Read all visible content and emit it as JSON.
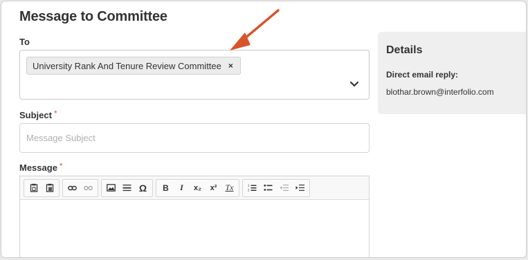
{
  "form": {
    "title": "Message to Committee",
    "to_label": "To",
    "to_chip": "University Rank And Tenure Review Committee",
    "chip_remove": "×",
    "subject_label": "Subject",
    "subject_placeholder": "Message Subject",
    "message_label": "Message",
    "required_mark": "*"
  },
  "toolbar": {
    "bold": "B",
    "italic": "I",
    "subscript": "x₂",
    "superscript": "x²",
    "remove_format": "Tx",
    "special_char": "Ω"
  },
  "details": {
    "title": "Details",
    "reply_label": "Direct email reply:",
    "reply_email": "blothar.brown@interfolio.com"
  },
  "colors": {
    "required": "#d9534f",
    "annotation_arrow": "#d9532b",
    "details_bg": "#efefef"
  }
}
